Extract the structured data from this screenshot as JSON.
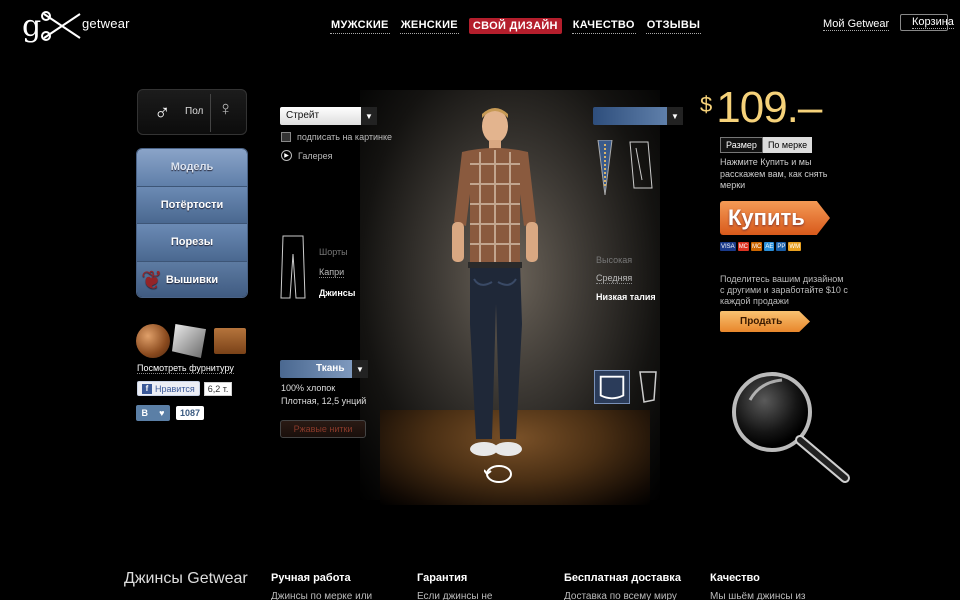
{
  "brand": {
    "logo_text": "getwear"
  },
  "nav": {
    "items": [
      {
        "label": "МУЖСКИЕ",
        "active": false
      },
      {
        "label": "ЖЕНСКИЕ",
        "active": false
      },
      {
        "label": "СВОЙ ДИЗАЙН",
        "active": true
      },
      {
        "label": "КАЧЕСТВО",
        "active": false
      },
      {
        "label": "ОТЗЫВЫ",
        "active": false
      }
    ],
    "my_account": "Мой Getwear",
    "cart": "Корзина"
  },
  "gender": {
    "label": "Пол",
    "male_icon": "♂",
    "female_icon": "♀"
  },
  "side_menu": {
    "items": [
      {
        "label": "Модель"
      },
      {
        "label": "Потёртости"
      },
      {
        "label": "Порезы"
      },
      {
        "label": "Вышивки"
      }
    ]
  },
  "hardware": {
    "link": "Посмотреть фурнитуру"
  },
  "social": {
    "fb_like": "Нравится",
    "fb_count": "6,2 т.",
    "vk_label": "В",
    "vk_count": "1087"
  },
  "fit": {
    "selected": "Стрейт",
    "caption_checkbox": "подписать на картинке",
    "gallery": "Галерея"
  },
  "length": {
    "options": [
      "Шорты",
      "Капри",
      "Джинсы"
    ],
    "selected": "Джинсы"
  },
  "fabric": {
    "selected": "Ткань",
    "line1": "100% хлопок",
    "line2": "Плотная, 12,5 унций",
    "thread_button": "Ржавые нитки"
  },
  "rise": {
    "options": [
      "Высокая",
      "Средняя",
      "Низкая талия"
    ],
    "selected": "Низкая талия"
  },
  "price": {
    "currency": "$",
    "value": "109.–"
  },
  "size": {
    "tab_size": "Размер",
    "tab_custom": "По мерке",
    "note": "Нажмите Купить и мы расскажем вам, как снять мерки"
  },
  "buy": {
    "label": "Купить"
  },
  "payment_cards": [
    "VISA",
    "MC",
    "MC",
    "AE",
    "PP",
    "WM"
  ],
  "share": {
    "note": "Поделитесь вашим дизайном с другими и заработайте $10 с каждой продажи",
    "sell_label": "Продать"
  },
  "footer": {
    "title": "Джинсы Getwear",
    "cols": [
      {
        "heading": "Ручная работа",
        "text": "Джинсы по мерке или"
      },
      {
        "heading": "Гарантия",
        "text": "Если джинсы не"
      },
      {
        "heading": "Бесплатная доставка",
        "text": "Доставка по всему миру"
      },
      {
        "heading": "Качество",
        "text": "Мы шьём джинсы из"
      }
    ]
  },
  "colors": {
    "accent_red": "#b41e2c",
    "price_gold": "#f6d27a",
    "buy_orange": "#d8591b",
    "menu_blue": "#4a6890"
  }
}
